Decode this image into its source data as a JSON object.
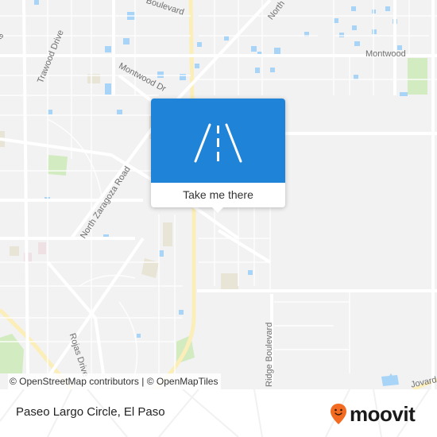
{
  "map": {
    "street_labels": [
      {
        "name": "street-label-boulevard",
        "text": "Boulevard"
      },
      {
        "name": "street-label-north",
        "text": "North"
      },
      {
        "name": "street-label-drive-left",
        "text": "Drive"
      },
      {
        "name": "street-label-trawood-drive",
        "text": "Trawood Drive"
      },
      {
        "name": "street-label-montwood-drive",
        "text": "Montwood Dr"
      },
      {
        "name": "street-label-montwood",
        "text": "Montwood"
      },
      {
        "name": "street-label-north-zaragoza-road",
        "text": "North Zaragoza Road"
      },
      {
        "name": "street-label-rojas-drive",
        "text": "Rojas Drive"
      },
      {
        "name": "street-label-ridge-boulevard",
        "text": "Ridge Boulevard"
      },
      {
        "name": "street-label-bottom-right",
        "text": "Jovard"
      }
    ],
    "attribution": "© OpenStreetMap contributors | © OpenMapTiles",
    "colors": {
      "background": "#f2f2f2",
      "road": "#ffffff",
      "highway": "#fbeeb8",
      "water": "#a7d4f7",
      "park": "#d3ebc0",
      "landuse": "#e8e4d6"
    }
  },
  "popup": {
    "icon": "road-icon",
    "button_label": "Take me there",
    "accent_color": "#1f84d8"
  },
  "footer": {
    "place_name": "Paseo Largo Circle, El Paso",
    "brand": "moovit",
    "brand_color": "#f26b21"
  }
}
